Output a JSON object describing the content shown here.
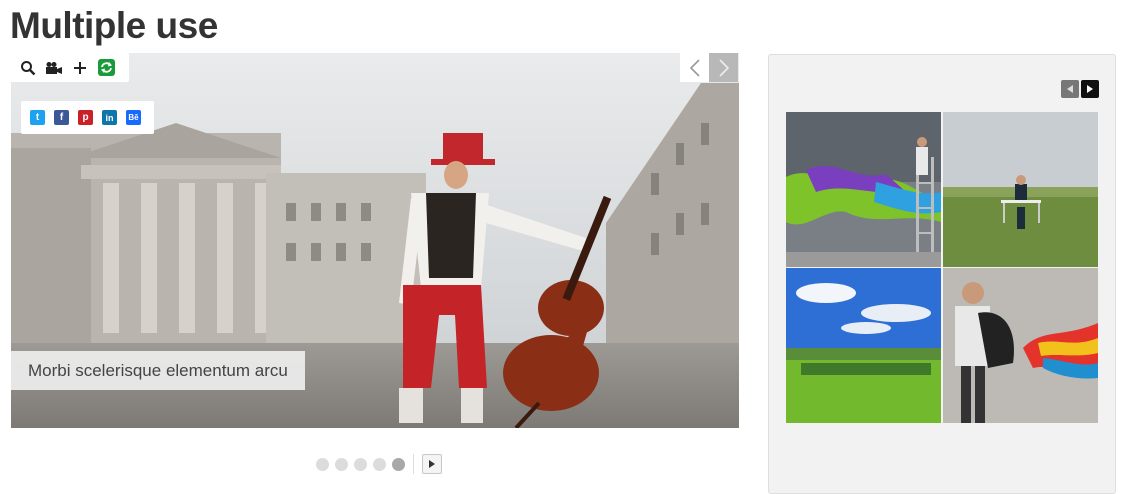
{
  "page": {
    "title": "Multiple use"
  },
  "slider": {
    "caption": "Morbi scelerisque elementum arcu",
    "toolbar": [
      "search-icon",
      "video-icon",
      "plus-icon",
      "refresh-icon"
    ],
    "share": [
      {
        "name": "twitter",
        "glyph": "t",
        "color": "#1da1f2"
      },
      {
        "name": "facebook",
        "glyph": "f",
        "color": "#3b5998"
      },
      {
        "name": "pinterest",
        "glyph": "p",
        "color": "#cb2027"
      },
      {
        "name": "linkedin",
        "glyph": "in",
        "color": "#0e76a8"
      },
      {
        "name": "behance",
        "glyph": "Bē",
        "color": "#1769ff"
      }
    ],
    "prev_glyph": "<",
    "next_glyph": ">"
  },
  "pagination": {
    "dots": 5,
    "active_index": 4
  },
  "gallery": {
    "thumbnails": [
      {
        "subject": "paint splash on ladder"
      },
      {
        "subject": "man at desk in field"
      },
      {
        "subject": "blue sky green meadow"
      },
      {
        "subject": "boy with backpack paint"
      }
    ]
  },
  "colors": {
    "title": "#333333",
    "accent_refresh": "#1a9b3a",
    "panel_bg": "#f2f2f2"
  }
}
